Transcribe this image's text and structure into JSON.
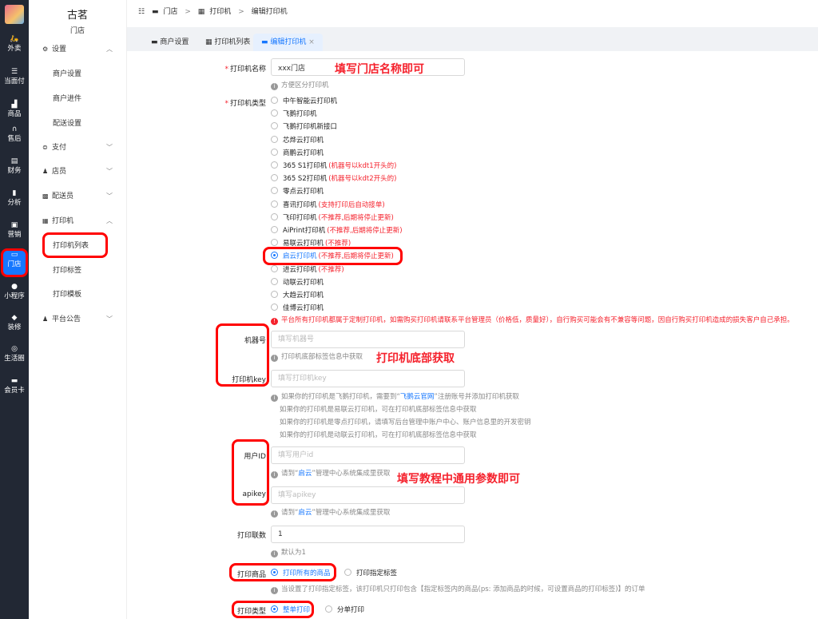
{
  "rail": [
    {
      "icon": "bike-icon",
      "glyph": "🛵",
      "label": "外卖"
    },
    {
      "icon": "list-icon",
      "glyph": "☰",
      "label": "当面付"
    },
    {
      "icon": "shop-icon",
      "glyph": "▟",
      "label": "商品"
    },
    {
      "icon": "headset-icon",
      "glyph": "∩",
      "label": "售后"
    },
    {
      "icon": "finance-icon",
      "glyph": "▤",
      "label": "财务"
    },
    {
      "icon": "chart-icon",
      "glyph": "▮",
      "label": "分析"
    },
    {
      "icon": "gift-icon",
      "glyph": "▣",
      "label": "营销"
    },
    {
      "icon": "store-icon",
      "glyph": "▭",
      "label": "门店"
    },
    {
      "icon": "chat-icon",
      "glyph": "●",
      "label": "小程序"
    },
    {
      "icon": "brush-icon",
      "glyph": "◆",
      "label": "装修"
    },
    {
      "icon": "circle-icon",
      "glyph": "◎",
      "label": "生活圈"
    },
    {
      "icon": "card-icon",
      "glyph": "▬",
      "label": "会员卡"
    }
  ],
  "brand": {
    "name": "古茗",
    "sub": "门店"
  },
  "side": {
    "settings": "设置",
    "merchant_settings": "商户设置",
    "merchant_onboard": "商户进件",
    "delivery_settings": "配送设置",
    "pay": "支付",
    "staff": "店员",
    "courier": "配送员",
    "printer": "打印机",
    "printer_list": "打印机列表",
    "print_label": "打印标签",
    "print_template": "打印模板",
    "announce": "平台公告"
  },
  "crumb": {
    "store": "门店",
    "printer": "打印机",
    "edit": "编辑打印机"
  },
  "tabs": {
    "merchant": "商户设置",
    "list": "打印机列表",
    "edit": "编辑打印机"
  },
  "form": {
    "name_label": "打印机名称",
    "name_value": "xxx门店",
    "name_hint": "方便区分打印机",
    "type_label": "打印机类型",
    "types": [
      {
        "name": "中午智能云打印机",
        "note": ""
      },
      {
        "name": "飞鹅打印机",
        "note": ""
      },
      {
        "name": "飞鹅打印机新接口",
        "note": ""
      },
      {
        "name": "芯烨云打印机",
        "note": ""
      },
      {
        "name": "商鹏云打印机",
        "note": ""
      },
      {
        "name": "365 S1打印机",
        "note": "(机器号以kdt1开头的)"
      },
      {
        "name": "365 S2打印机",
        "note": "(机器号以kdt2开头的)"
      },
      {
        "name": "零点云打印机",
        "note": ""
      },
      {
        "name": "喜讯打印机",
        "note": "(支持打印后自动接单)"
      },
      {
        "name": "飞印打印机",
        "note": "(不推荐,后期将停止更新)"
      },
      {
        "name": "AiPrint打印机",
        "note": "(不推荐,后期将停止更新)"
      },
      {
        "name": "易联云打印机",
        "note": "(不推荐)"
      },
      {
        "name": "启云打印机",
        "note": "(不推荐,后期将停止更新)"
      },
      {
        "name": "进云打印机",
        "note": "(不推荐)"
      },
      {
        "name": "动联云打印机",
        "note": ""
      },
      {
        "name": "大趋云打印机",
        "note": ""
      },
      {
        "name": "佳博云打印机",
        "note": ""
      }
    ],
    "type_warn": "平台所有打印机都属于定制打印机，如需购买打印机请联系平台管理员（价格低，质量好），自行购买可能会有不兼容等问题，因自行购买打印机造成的损失客户自己承担。",
    "machine_label": "机器号",
    "machine_ph": "填写机器号",
    "machine_hint": "打印机底部标签信息中获取",
    "key_label": "打印机key",
    "key_ph": "填写打印机key",
    "key_hint1_a": "如果你的打印机是飞鹅打印机，需要到“",
    "key_hint1_link": "飞鹅云官网",
    "key_hint1_b": "”注册账号并添加打印机获取",
    "key_hint2": "如果你的打印机是易联云打印机，可在打印机底部标签信息中获取",
    "key_hint3": "如果你的打印机是零点打印机，请填写后台管理中账户中心、账户信息里的开发密钥",
    "key_hint4": "如果你的打印机是动联云打印机，可在打印机底部标签信息中获取",
    "uid_label": "用户ID",
    "uid_ph": "填写用户id",
    "uid_hint_a": "请到“",
    "uid_hint_link": "启云",
    "uid_hint_b": "”管理中心系统集成里获取",
    "apikey_label": "apikey",
    "apikey_ph": "填写apikey",
    "copies_label": "打印联数",
    "copies_value": "1",
    "copies_hint": "默认为1",
    "goods_label": "打印商品",
    "goods_all": "打印所有的商品",
    "goods_tag": "打印指定标签",
    "goods_hint": "当设置了打印指定标签，该打印机只打印包含【指定标签内的商品(ps: 添加商品的时候，可设置商品的打印标签)】的订单",
    "ptype_label": "打印类型",
    "ptype_whole": "整单打印",
    "ptype_split": "分单打印"
  },
  "annotations": {
    "a1": "填写门店名称即可",
    "a2": "打印机底部获取",
    "a3": "填写教程中通用参数即可"
  },
  "colors": {
    "accent": "#1677ff",
    "red": "#f5222d",
    "rail": "#222834"
  }
}
